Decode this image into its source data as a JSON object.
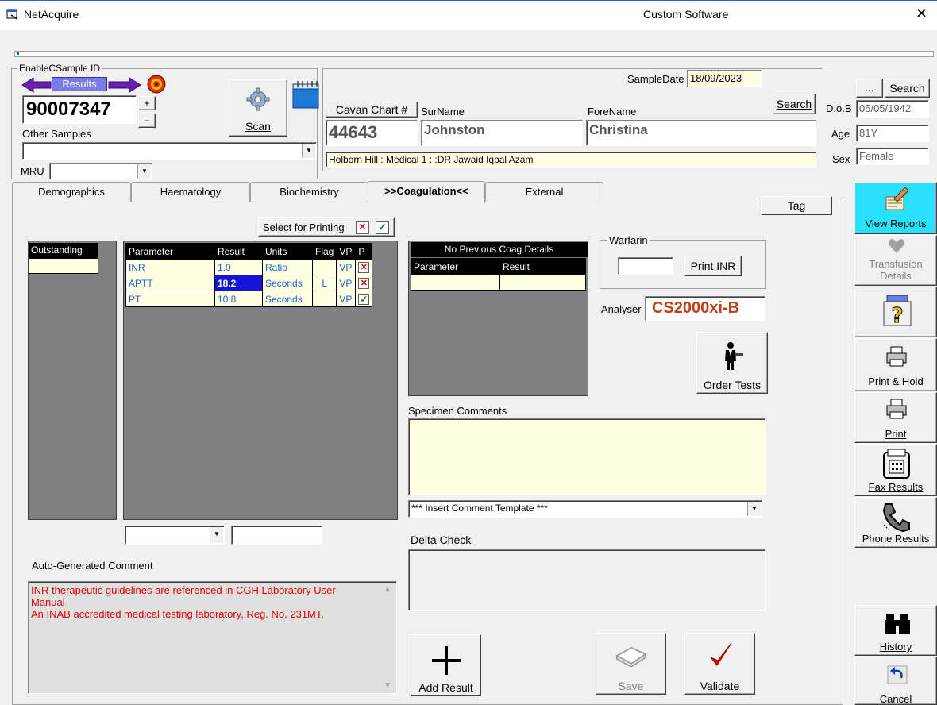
{
  "window": {
    "app_title": "NetAcquire",
    "center_title": "Custom Software",
    "close_glyph": "✕"
  },
  "sample": {
    "group_label": "EnableCSample ID",
    "results_label": "Results",
    "sample_id": "90007347",
    "plus": "+",
    "minus": "−",
    "other_samples_label": "Other Samples",
    "mru_label": "MRU",
    "scan_label": "Scan"
  },
  "patient": {
    "sample_date_label": "SampleDate",
    "sample_date": "18/09/2023",
    "chart_label": "Cavan Chart #",
    "chart_value": "44643",
    "surname_label": "SurName",
    "surname": "Johnston",
    "forename_label": "ForeName",
    "forename": "Christina",
    "search_label": "Search",
    "ellipsis_label": "...",
    "search2_label": "Search",
    "dob_label": "D.o.B",
    "dob": "05/05/1942",
    "age_label": "Age",
    "age": "81Y",
    "sex_label": "Sex",
    "sex": "Female",
    "location": "Holborn Hill : Medical 1 : :DR Jawaid Iqbal Azam"
  },
  "tabs": [
    "Demographics",
    "Haematology",
    "Biochemistry",
    ">>Coagulation<<",
    "External"
  ],
  "tag_label": "Tag",
  "select_for_printing": "Select for Printing",
  "outstanding_label": "Outstanding",
  "results_table": {
    "headers": [
      "Parameter",
      "Result",
      "Units",
      "Flag",
      "VP",
      "P"
    ],
    "rows": [
      {
        "parameter": "INR",
        "result": "1.0",
        "units": "Ratio",
        "flag": "",
        "vp": "VP",
        "p": "✕"
      },
      {
        "parameter": "APTT",
        "result": "18.2",
        "units": "Seconds",
        "flag": "L",
        "vp": "VP",
        "p": "✕"
      },
      {
        "parameter": "PT",
        "result": "10.8",
        "units": "Seconds",
        "flag": "",
        "vp": "VP",
        "p": "✓"
      }
    ]
  },
  "prev_coag": {
    "title": "No Previous Coag Details",
    "headers": [
      "Parameter",
      "Result"
    ]
  },
  "warfarin": {
    "label": "Warfarin",
    "print_inr": "Print INR"
  },
  "analyser": {
    "label": "Analyser",
    "value": "CS2000xi-B",
    "color": "#c0401a"
  },
  "order_tests": "Order Tests",
  "specimen_comments_label": "Specimen Comments",
  "comment_template": "*** Insert Comment Template ***",
  "delta_check_label": "Delta Check",
  "auto_comment": {
    "label": "Auto-Generated Comment",
    "line1": "INR therapeutic guidelines are referenced in CGH Laboratory User Manual",
    "line2": "An INAB accredited medical testing laboratory, Reg. No. 231MT.",
    "color": "#e00000"
  },
  "buttons": {
    "add_result": "Add Result",
    "save": "Save",
    "validate": "Validate"
  },
  "sidebar": {
    "view_reports": "View Reports",
    "transfusion": "Transfusion Details",
    "print_hold": "Print & Hold",
    "print": "Print",
    "fax": "Fax Results",
    "phone": "Phone Results",
    "history": "History",
    "cancel": "Cancel"
  },
  "colors": {
    "accent_blue": "#1e5fd6",
    "cell_yellow": "#ffffe1",
    "selected_cell": "#1414d6"
  }
}
